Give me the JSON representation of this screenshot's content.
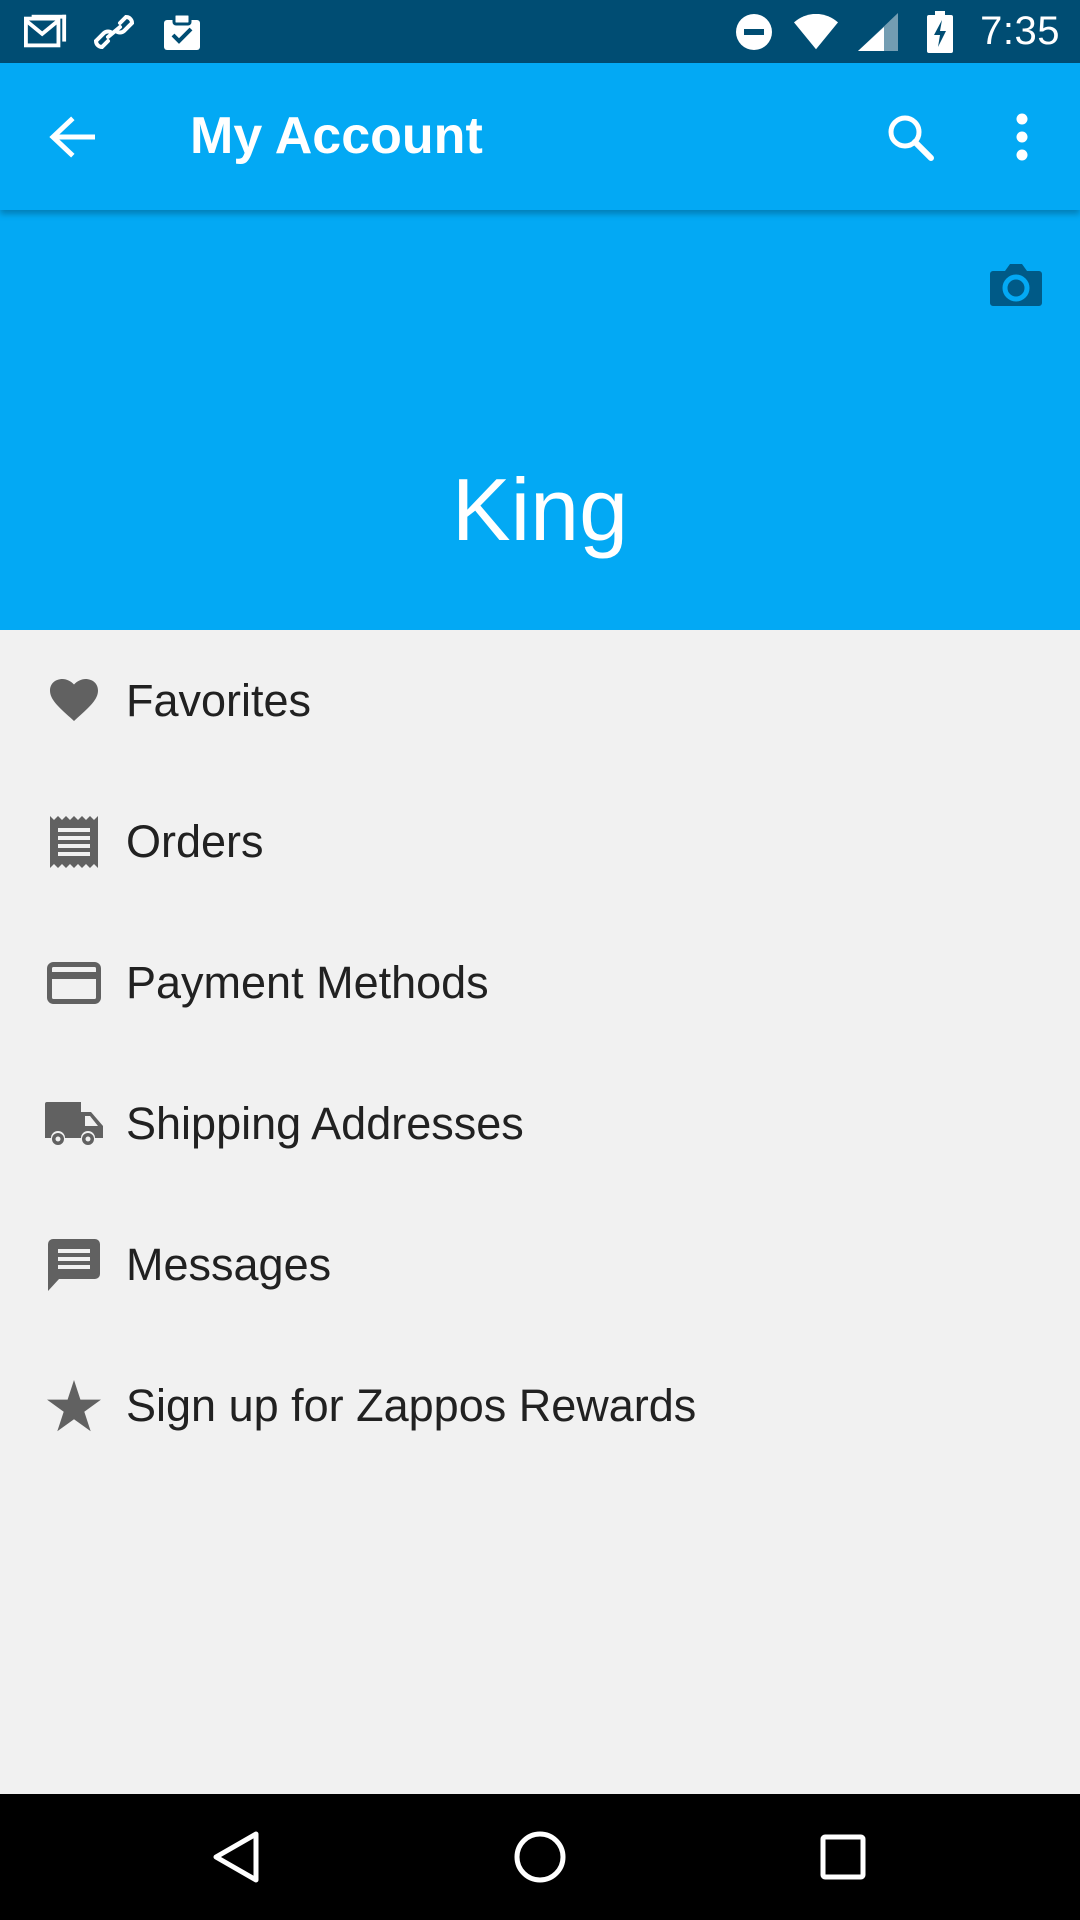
{
  "status_bar": {
    "time": "7:35",
    "left_icons": [
      "gmail-icon",
      "link-icon",
      "clipboard-check-icon"
    ],
    "right_icons": [
      "do-not-disturb-icon",
      "wifi-icon",
      "signal-icon",
      "battery-charging-icon"
    ]
  },
  "app_bar": {
    "title": "My Account",
    "back_icon": "arrow-back-icon",
    "search_icon": "search-icon",
    "menu_icon": "more-vert-icon"
  },
  "profile": {
    "name": "King",
    "camera_icon": "camera-icon"
  },
  "menu": {
    "items": [
      {
        "label": "Favorites",
        "icon": "heart-icon"
      },
      {
        "label": "Orders",
        "icon": "receipt-icon"
      },
      {
        "label": "Payment Methods",
        "icon": "credit-card-icon"
      },
      {
        "label": "Shipping Addresses",
        "icon": "truck-icon"
      },
      {
        "label": "Messages",
        "icon": "message-icon"
      },
      {
        "label": "Sign up for Zappos Rewards",
        "icon": "star-icon"
      }
    ]
  },
  "nav_bar": {
    "back_icon": "nav-back-icon",
    "home_icon": "nav-home-icon",
    "recents_icon": "nav-recents-icon"
  },
  "colors": {
    "status_bar": "#004d73",
    "primary": "#03a9f4",
    "camera_icon": "#005a87",
    "list_background": "#f1f1f1",
    "list_icon": "#616161",
    "list_text": "#212121"
  }
}
